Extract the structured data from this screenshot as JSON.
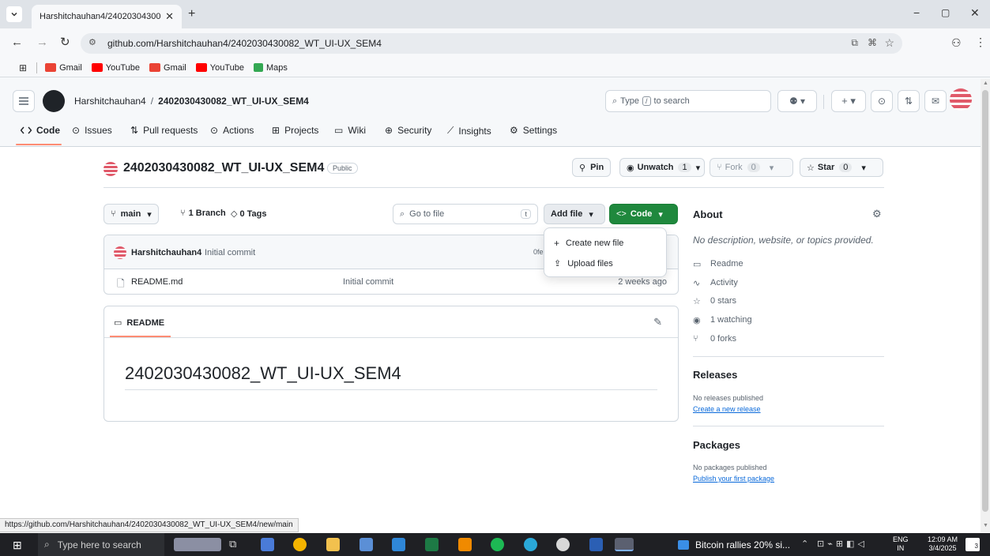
{
  "browser": {
    "tab_title": "Harshitchauhan4/24020304300",
    "url": "github.com/Harshitchauhan4/2402030430082_WT_UI-UX_SEM4",
    "bookmarks": [
      {
        "label": "Gmail",
        "icon": "gmail-icon",
        "color": "#ea4335"
      },
      {
        "label": "YouTube",
        "icon": "youtube-icon",
        "color": "#ff0000"
      },
      {
        "label": "Gmail",
        "icon": "gmail-icon",
        "color": "#ea4335"
      },
      {
        "label": "YouTube",
        "icon": "youtube-icon",
        "color": "#ff0000"
      },
      {
        "label": "Maps",
        "icon": "maps-icon",
        "color": "#34a853"
      }
    ]
  },
  "header": {
    "owner": "Harshitchauhan4",
    "separator": "/",
    "repo": "2402030430082_WT_UI-UX_SEM4",
    "search_placeholder": "Type",
    "search_key": "/",
    "search_suffix": "to search",
    "tabs": [
      {
        "label": "Code",
        "icon": "code-icon"
      },
      {
        "label": "Issues",
        "icon": "issue-icon"
      },
      {
        "label": "Pull requests",
        "icon": "pull-request-icon"
      },
      {
        "label": "Actions",
        "icon": "play-icon"
      },
      {
        "label": "Projects",
        "icon": "table-icon"
      },
      {
        "label": "Wiki",
        "icon": "book-icon"
      },
      {
        "label": "Security",
        "icon": "shield-icon"
      },
      {
        "label": "Insights",
        "icon": "graph-icon"
      },
      {
        "label": "Settings",
        "icon": "gear-icon"
      }
    ]
  },
  "repo": {
    "name": "2402030430082_WT_UI-UX_SEM4",
    "visibility": "Public",
    "pin_label": "Pin",
    "unwatch_label": "Unwatch",
    "unwatch_count": "1",
    "fork_label": "Fork",
    "fork_count": "0",
    "star_label": "Star",
    "star_count": "0"
  },
  "filebar": {
    "branch": "main",
    "branch_count": "1 Branch",
    "tag_count": "0 Tags",
    "goto_placeholder": "Go to file",
    "goto_key": "t",
    "add_file": "Add file",
    "code_button": "Code"
  },
  "dropdown": {
    "items": [
      {
        "label": "Create new file",
        "icon": "plus-icon"
      },
      {
        "label": "Upload files",
        "icon": "upload-icon"
      }
    ]
  },
  "commit": {
    "author": "Harshitchauhan4",
    "message": "Initial commit",
    "hash_partial": "0fe"
  },
  "files": [
    {
      "name": "README.md",
      "message": "Initial commit",
      "time": "2 weeks ago"
    }
  ],
  "readme": {
    "tab_label": "README",
    "heading": "2402030430082_WT_UI-UX_SEM4"
  },
  "about": {
    "title": "About",
    "description": "No description, website, or topics provided.",
    "items": [
      {
        "label": "Readme",
        "icon": "book-icon"
      },
      {
        "label": "Activity",
        "icon": "pulse-icon"
      },
      {
        "label": "0 stars",
        "icon": "star-icon"
      },
      {
        "label": "1 watching",
        "icon": "eye-icon"
      },
      {
        "label": "0 forks",
        "icon": "fork-icon"
      }
    ],
    "releases_title": "Releases",
    "releases_text": "No releases published",
    "releases_link": "Create a new release",
    "packages_title": "Packages",
    "packages_text": "No packages published",
    "packages_link": "Publish your first package"
  },
  "status_url": "https://github.com/Harshitchauhan4/2402030430082_WT_UI-UX_SEM4/new/main",
  "taskbar": {
    "search_placeholder": "Type here to search",
    "news": "Bitcoin rallies 20% si...",
    "lang": "ENG",
    "region": "IN",
    "time": "12:09 AM",
    "date": "3/4/2025",
    "notif_count": "3"
  },
  "colors": {
    "accent_green": "#1f883d",
    "link": "#0969da",
    "selected_tab": "#fd8c73"
  }
}
